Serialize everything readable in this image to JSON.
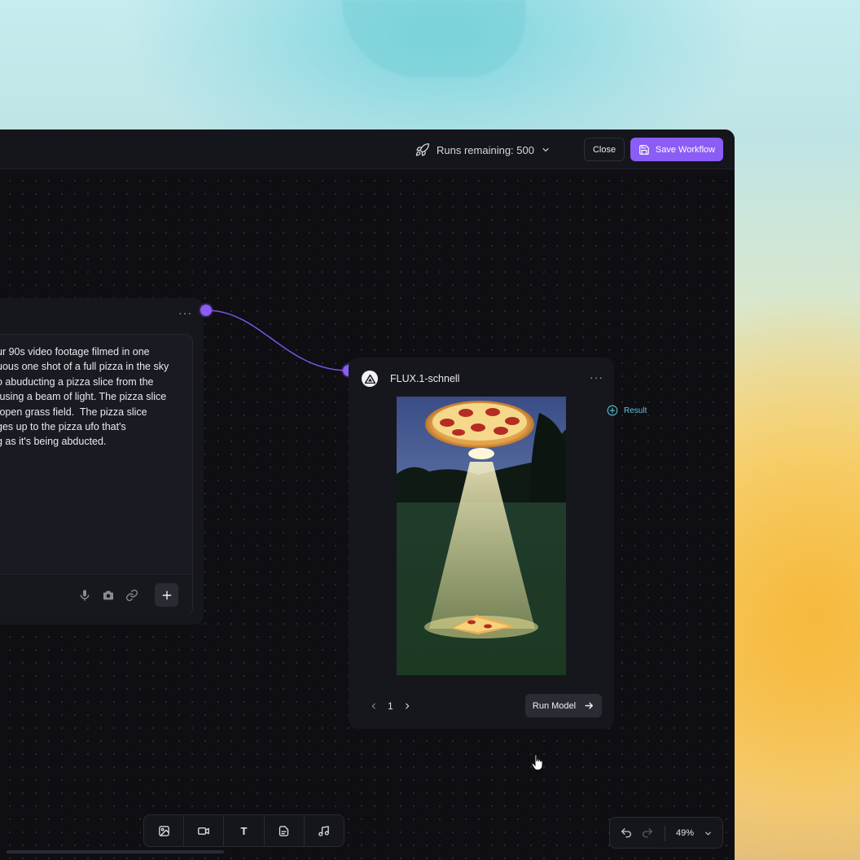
{
  "header": {
    "runs_label": "Runs remaining: 500",
    "close_label": "Close",
    "save_label": "Save Workflow"
  },
  "prompt_node": {
    "text_lines": [
      "ur 90s video footage filmed in one",
      "uous one shot of a full pizza in the sky",
      "o abuducting a pizza slice from the",
      " using a beam of light. The pizza slice",
      " open grass field.  The pizza slice",
      "ges up to the pizza ufo that's",
      "g as it's being abducted."
    ],
    "menu": "···"
  },
  "model_node": {
    "title": "FLUX.1-schnell",
    "menu": "···",
    "page": "1",
    "run_label": "Run Model",
    "output_label": "Result"
  },
  "zoom": {
    "level": "49%"
  },
  "toolbar": {
    "text_tool_label": "T"
  },
  "colors": {
    "accent": "#8b5cf6",
    "panel": "#16161d",
    "canvas": "#0e0e13",
    "result": "#5fc8d8"
  },
  "icons": [
    "rocket-icon",
    "chevron-down-icon",
    "save-icon",
    "mic-icon",
    "camera-icon",
    "link-icon",
    "plus-icon",
    "flux-logo-icon",
    "add-circle-icon",
    "chevron-left-icon",
    "chevron-right-icon",
    "arrow-right-icon",
    "hand-cursor-icon",
    "image-icon",
    "video-icon",
    "document-icon",
    "music-icon",
    "undo-icon",
    "redo-icon"
  ]
}
